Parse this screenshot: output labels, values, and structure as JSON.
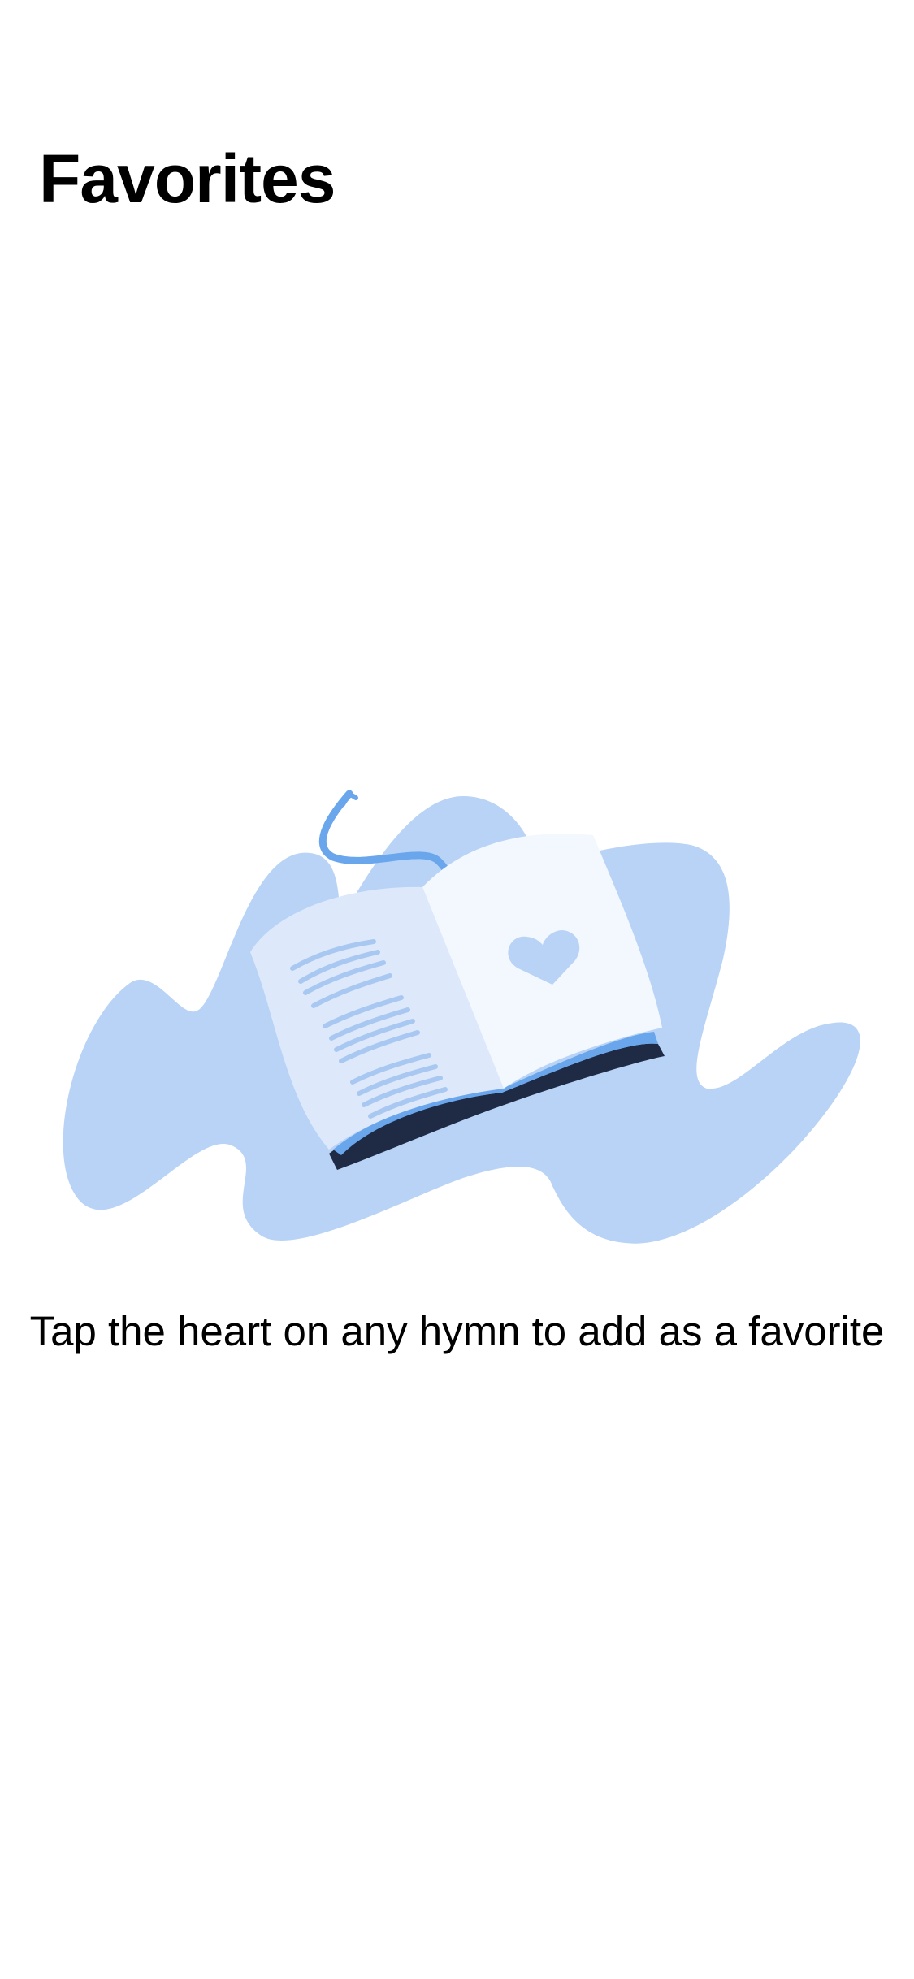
{
  "header": {
    "title": "Favorites"
  },
  "empty_state": {
    "illustration_icon": "open-book-heart-illustration-icon",
    "message": "Tap the heart on any hymn to add as a favorite"
  },
  "colors": {
    "background": "#ffffff",
    "text": "#000000",
    "blob": "#b8d3f6",
    "page_left": "#dde9fb",
    "page_right": "#f3f7fe",
    "accent": "#6aa6ec",
    "cover_dark": "#1f2a44"
  }
}
